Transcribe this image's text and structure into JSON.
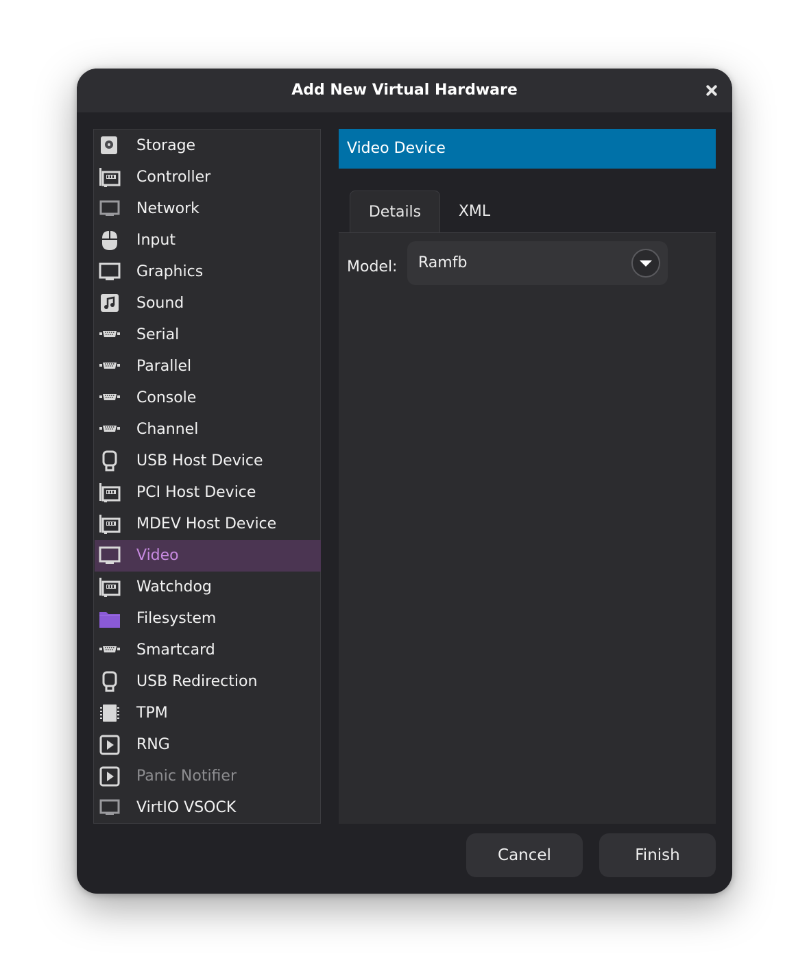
{
  "dialog": {
    "title": "Add New Virtual Hardware",
    "hardware_list": [
      {
        "label": "Storage",
        "icon": "disk-icon"
      },
      {
        "label": "Controller",
        "icon": "pci-card-icon"
      },
      {
        "label": "Network",
        "icon": "monitor-outline-icon"
      },
      {
        "label": "Input",
        "icon": "mouse-icon"
      },
      {
        "label": "Graphics",
        "icon": "monitor-icon"
      },
      {
        "label": "Sound",
        "icon": "music-note-icon"
      },
      {
        "label": "Serial",
        "icon": "serial-port-icon"
      },
      {
        "label": "Parallel",
        "icon": "serial-port-icon"
      },
      {
        "label": "Console",
        "icon": "serial-port-icon"
      },
      {
        "label": "Channel",
        "icon": "serial-port-icon"
      },
      {
        "label": "USB Host Device",
        "icon": "usb-plug-icon"
      },
      {
        "label": "PCI Host Device",
        "icon": "pci-card-icon"
      },
      {
        "label": "MDEV Host Device",
        "icon": "pci-card-icon"
      },
      {
        "label": "Video",
        "icon": "monitor-icon",
        "selected": true
      },
      {
        "label": "Watchdog",
        "icon": "pci-card-icon"
      },
      {
        "label": "Filesystem",
        "icon": "folder-icon"
      },
      {
        "label": "Smartcard",
        "icon": "serial-port-icon"
      },
      {
        "label": "USB Redirection",
        "icon": "usb-plug-icon"
      },
      {
        "label": "TPM",
        "icon": "chip-icon"
      },
      {
        "label": "RNG",
        "icon": "play-box-icon"
      },
      {
        "label": "Panic Notifier",
        "icon": "play-box-icon",
        "dimmed": true
      },
      {
        "label": "VirtIO VSOCK",
        "icon": "monitor-outline-icon"
      }
    ],
    "panel": {
      "header": "Video Device",
      "tabs": [
        {
          "label": "Details",
          "active": true
        },
        {
          "label": "XML",
          "active": false
        }
      ],
      "model_label": "Model:",
      "model_value": "Ramfb"
    },
    "buttons": {
      "cancel": "Cancel",
      "finish": "Finish"
    },
    "colors": {
      "header_blue": "#0071a8",
      "selected_bg": "#4b3552",
      "selected_text": "#c78ae0",
      "folder_purple": "#8a5ad6"
    }
  }
}
